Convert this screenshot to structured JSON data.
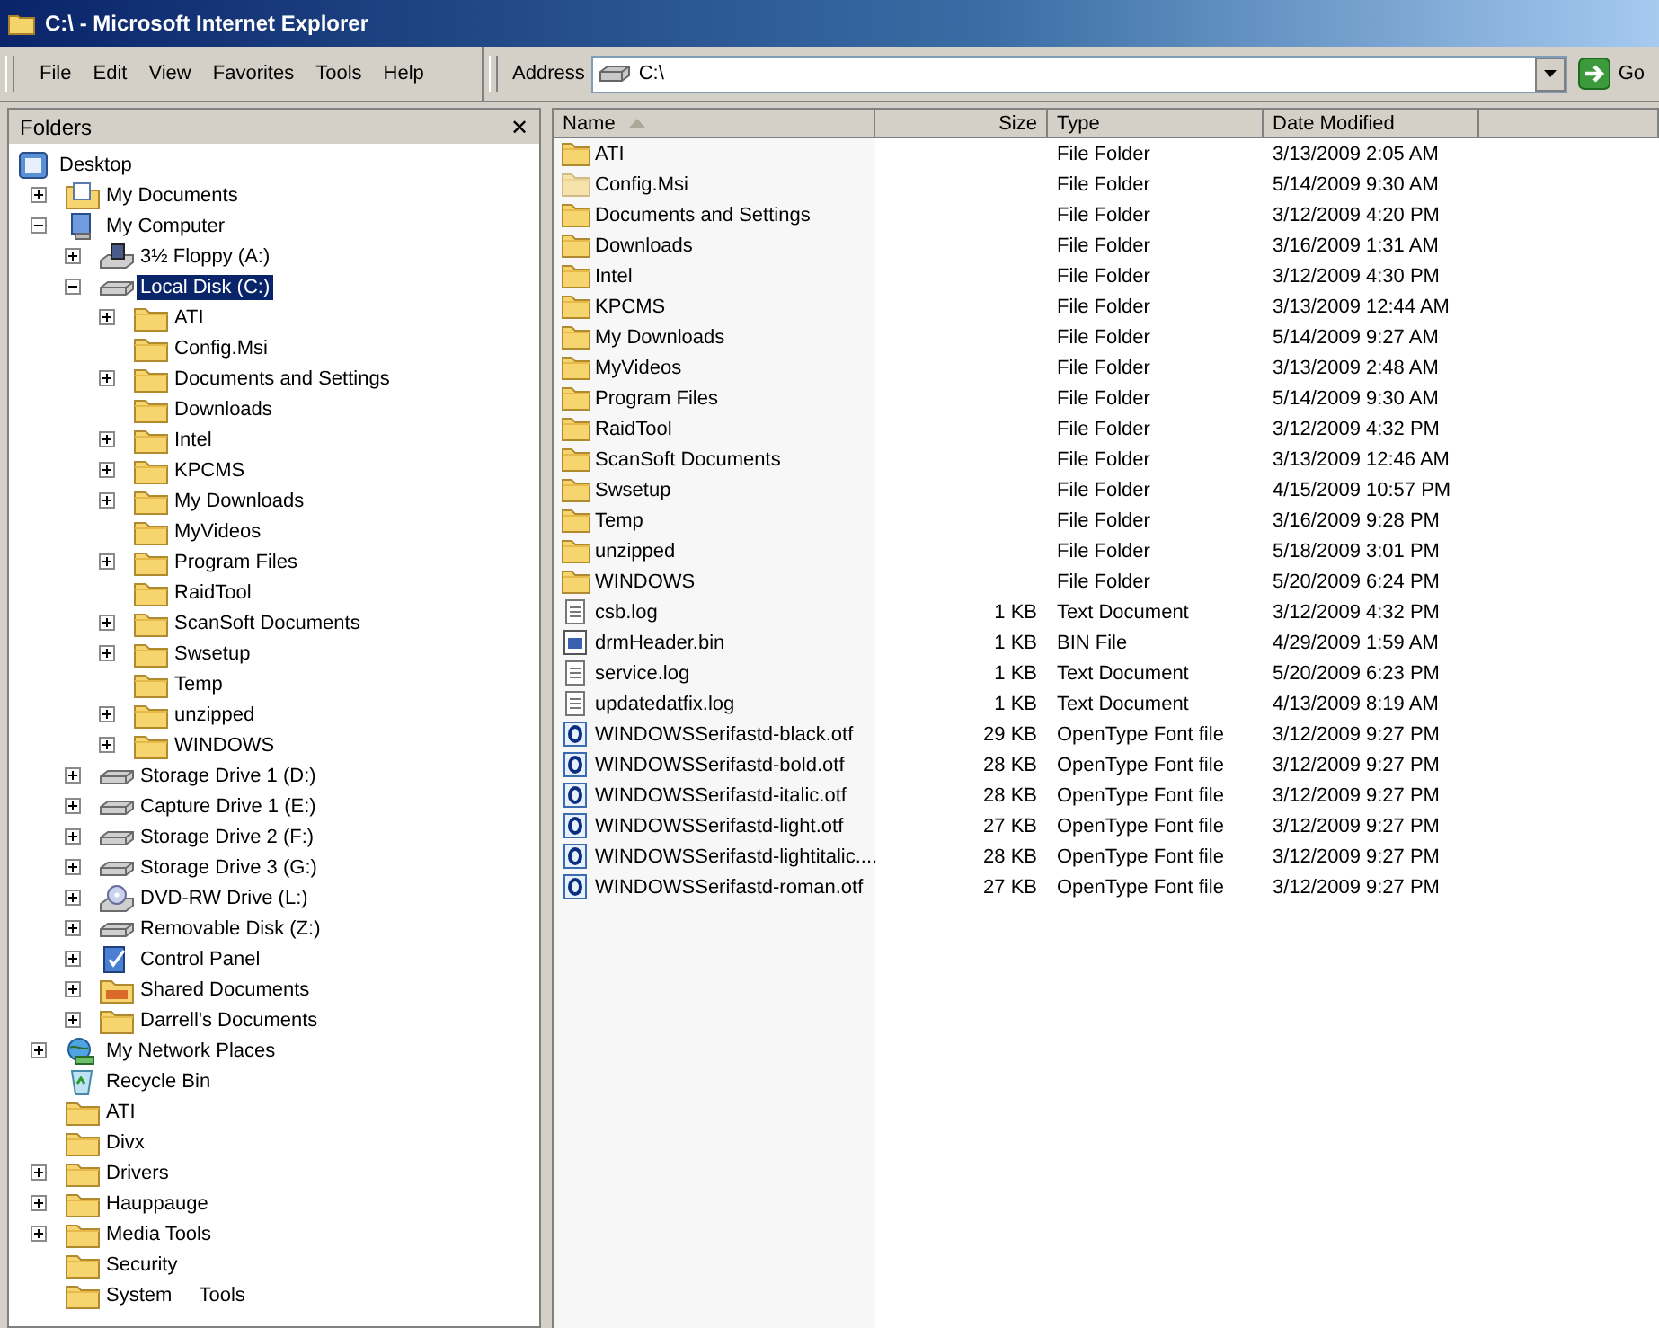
{
  "window": {
    "title": "C:\\ - Microsoft Internet Explorer"
  },
  "menu": [
    "File",
    "Edit",
    "View",
    "Favorites",
    "Tools",
    "Help"
  ],
  "address": {
    "label": "Address",
    "value": "C:\\",
    "go": "Go"
  },
  "folders_pane": {
    "title": "Folders",
    "close": "✕",
    "tree": [
      {
        "label": "Desktop",
        "kind": "desktop",
        "has_toggle": false,
        "selected": false,
        "children": [
          {
            "label": "My Documents",
            "kind": "documents",
            "has_toggle": true,
            "expanded": false,
            "selected": false
          },
          {
            "label": "My Computer",
            "kind": "computer",
            "has_toggle": true,
            "expanded": true,
            "selected": false,
            "children": [
              {
                "label": "3½ Floppy (A:)",
                "kind": "floppy",
                "has_toggle": true,
                "expanded": false,
                "selected": false
              },
              {
                "label": "Local Disk (C:)",
                "kind": "drive",
                "has_toggle": true,
                "expanded": true,
                "selected": true,
                "children": [
                  {
                    "label": "ATI",
                    "kind": "folder",
                    "has_toggle": true,
                    "expanded": false,
                    "selected": false
                  },
                  {
                    "label": "Config.Msi",
                    "kind": "folder",
                    "has_toggle": false,
                    "selected": false
                  },
                  {
                    "label": "Documents and Settings",
                    "kind": "folder",
                    "has_toggle": true,
                    "expanded": false,
                    "selected": false
                  },
                  {
                    "label": "Downloads",
                    "kind": "folder",
                    "has_toggle": false,
                    "selected": false
                  },
                  {
                    "label": "Intel",
                    "kind": "folder",
                    "has_toggle": true,
                    "expanded": false,
                    "selected": false
                  },
                  {
                    "label": "KPCMS",
                    "kind": "folder",
                    "has_toggle": true,
                    "expanded": false,
                    "selected": false
                  },
                  {
                    "label": "My Downloads",
                    "kind": "folder",
                    "has_toggle": true,
                    "expanded": false,
                    "selected": false
                  },
                  {
                    "label": "MyVideos",
                    "kind": "folder",
                    "has_toggle": false,
                    "selected": false
                  },
                  {
                    "label": "Program Files",
                    "kind": "folder",
                    "has_toggle": true,
                    "expanded": false,
                    "selected": false
                  },
                  {
                    "label": "RaidTool",
                    "kind": "folder",
                    "has_toggle": false,
                    "selected": false
                  },
                  {
                    "label": "ScanSoft Documents",
                    "kind": "folder",
                    "has_toggle": true,
                    "expanded": false,
                    "selected": false
                  },
                  {
                    "label": "Swsetup",
                    "kind": "folder",
                    "has_toggle": true,
                    "expanded": false,
                    "selected": false
                  },
                  {
                    "label": "Temp",
                    "kind": "folder",
                    "has_toggle": false,
                    "selected": false
                  },
                  {
                    "label": "unzipped",
                    "kind": "folder",
                    "has_toggle": true,
                    "expanded": false,
                    "selected": false
                  },
                  {
                    "label": "WINDOWS",
                    "kind": "folder",
                    "has_toggle": true,
                    "expanded": false,
                    "selected": false
                  }
                ]
              },
              {
                "label": "Storage Drive 1 (D:)",
                "kind": "drive",
                "has_toggle": true,
                "expanded": false,
                "selected": false
              },
              {
                "label": "Capture Drive 1 (E:)",
                "kind": "drive",
                "has_toggle": true,
                "expanded": false,
                "selected": false
              },
              {
                "label": "Storage Drive 2 (F:)",
                "kind": "drive",
                "has_toggle": true,
                "expanded": false,
                "selected": false
              },
              {
                "label": "Storage Drive 3 (G:)",
                "kind": "drive",
                "has_toggle": true,
                "expanded": false,
                "selected": false
              },
              {
                "label": "DVD-RW Drive (L:)",
                "kind": "cdrom",
                "has_toggle": true,
                "expanded": false,
                "selected": false
              },
              {
                "label": "Removable Disk (Z:)",
                "kind": "drive",
                "has_toggle": true,
                "expanded": false,
                "selected": false
              },
              {
                "label": "Control Panel",
                "kind": "control-panel",
                "has_toggle": true,
                "expanded": false,
                "selected": false
              },
              {
                "label": "Shared Documents",
                "kind": "shared",
                "has_toggle": true,
                "expanded": false,
                "selected": false
              },
              {
                "label": "Darrell's Documents",
                "kind": "folder",
                "has_toggle": true,
                "expanded": false,
                "selected": false
              }
            ]
          },
          {
            "label": "My Network Places",
            "kind": "network",
            "has_toggle": true,
            "expanded": false,
            "selected": false
          },
          {
            "label": "Recycle Bin",
            "kind": "recycle",
            "has_toggle": false,
            "selected": false
          },
          {
            "label": "ATI",
            "kind": "folder",
            "has_toggle": false,
            "selected": false
          },
          {
            "label": "Divx",
            "kind": "folder",
            "has_toggle": false,
            "selected": false
          },
          {
            "label": "Drivers",
            "kind": "folder",
            "has_toggle": true,
            "expanded": false,
            "selected": false
          },
          {
            "label": "Hauppauge",
            "kind": "folder",
            "has_toggle": true,
            "expanded": false,
            "selected": false
          },
          {
            "label": "Media Tools",
            "kind": "folder",
            "has_toggle": true,
            "expanded": false,
            "selected": false
          },
          {
            "label": "Security",
            "kind": "folder",
            "has_toggle": false,
            "selected": false
          },
          {
            "label": "System     Tools",
            "kind": "folder",
            "has_toggle": false,
            "selected": false
          }
        ]
      }
    ]
  },
  "file_list": {
    "columns": [
      "Name",
      "Size",
      "Type",
      "Date Modified"
    ],
    "rows": [
      {
        "name": "ATI",
        "kind": "folder",
        "size": "",
        "type": "File Folder",
        "date": "3/13/2009 2:05 AM"
      },
      {
        "name": "Config.Msi",
        "kind": "hidden-folder",
        "size": "",
        "type": "File Folder",
        "date": "5/14/2009 9:30 AM"
      },
      {
        "name": "Documents and Settings",
        "kind": "folder",
        "size": "",
        "type": "File Folder",
        "date": "3/12/2009 4:20 PM"
      },
      {
        "name": "Downloads",
        "kind": "folder",
        "size": "",
        "type": "File Folder",
        "date": "3/16/2009 1:31 AM"
      },
      {
        "name": "Intel",
        "kind": "folder",
        "size": "",
        "type": "File Folder",
        "date": "3/12/2009 4:30 PM"
      },
      {
        "name": "KPCMS",
        "kind": "folder",
        "size": "",
        "type": "File Folder",
        "date": "3/13/2009 12:44 AM"
      },
      {
        "name": "My Downloads",
        "kind": "folder",
        "size": "",
        "type": "File Folder",
        "date": "5/14/2009 9:27 AM"
      },
      {
        "name": "MyVideos",
        "kind": "folder",
        "size": "",
        "type": "File Folder",
        "date": "3/13/2009 2:48 AM"
      },
      {
        "name": "Program Files",
        "kind": "folder",
        "size": "",
        "type": "File Folder",
        "date": "5/14/2009 9:30 AM"
      },
      {
        "name": "RaidTool",
        "kind": "folder",
        "size": "",
        "type": "File Folder",
        "date": "3/12/2009 4:32 PM"
      },
      {
        "name": "ScanSoft Documents",
        "kind": "folder",
        "size": "",
        "type": "File Folder",
        "date": "3/13/2009 12:46 AM"
      },
      {
        "name": "Swsetup",
        "kind": "folder",
        "size": "",
        "type": "File Folder",
        "date": "4/15/2009 10:57 PM"
      },
      {
        "name": "Temp",
        "kind": "folder",
        "size": "",
        "type": "File Folder",
        "date": "3/16/2009 9:28 PM"
      },
      {
        "name": "unzipped",
        "kind": "folder",
        "size": "",
        "type": "File Folder",
        "date": "5/18/2009 3:01 PM"
      },
      {
        "name": "WINDOWS",
        "kind": "folder",
        "size": "",
        "type": "File Folder",
        "date": "5/20/2009 6:24 PM"
      },
      {
        "name": "csb.log",
        "kind": "text",
        "size": "1 KB",
        "type": "Text Document",
        "date": "3/12/2009 4:32 PM"
      },
      {
        "name": "drmHeader.bin",
        "kind": "bin",
        "size": "1 KB",
        "type": "BIN File",
        "date": "4/29/2009 1:59 AM"
      },
      {
        "name": "service.log",
        "kind": "text",
        "size": "1 KB",
        "type": "Text Document",
        "date": "5/20/2009 6:23 PM"
      },
      {
        "name": "updatedatfix.log",
        "kind": "text",
        "size": "1 KB",
        "type": "Text Document",
        "date": "4/13/2009 8:19 AM"
      },
      {
        "name": "WINDOWSSerifastd-black.otf",
        "kind": "font",
        "size": "29 KB",
        "type": "OpenType Font file",
        "date": "3/12/2009 9:27 PM"
      },
      {
        "name": "WINDOWSSerifastd-bold.otf",
        "kind": "font",
        "size": "28 KB",
        "type": "OpenType Font file",
        "date": "3/12/2009 9:27 PM"
      },
      {
        "name": "WINDOWSSerifastd-italic.otf",
        "kind": "font",
        "size": "28 KB",
        "type": "OpenType Font file",
        "date": "3/12/2009 9:27 PM"
      },
      {
        "name": "WINDOWSSerifastd-light.otf",
        "kind": "font",
        "size": "27 KB",
        "type": "OpenType Font file",
        "date": "3/12/2009 9:27 PM"
      },
      {
        "name": "WINDOWSSerifastd-lightitalic....",
        "kind": "font",
        "size": "28 KB",
        "type": "OpenType Font file",
        "date": "3/12/2009 9:27 PM"
      },
      {
        "name": "WINDOWSSerifastd-roman.otf",
        "kind": "font",
        "size": "27 KB",
        "type": "OpenType Font file",
        "date": "3/12/2009 9:27 PM"
      }
    ]
  }
}
